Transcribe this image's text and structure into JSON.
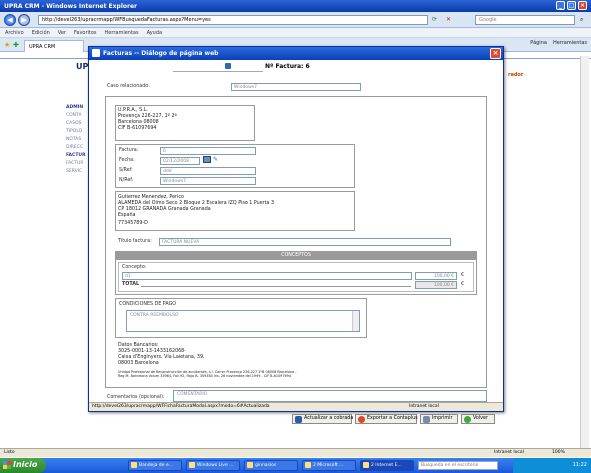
{
  "browser": {
    "title": "UPRA CRM - Windows Internet Explorer",
    "url": "http://devel263/upracrmapp/WFBusquedaFacturas.aspx?Menu=yes",
    "search_placeholder": "Google",
    "menu": [
      "Archivo",
      "Edición",
      "Ver",
      "Favoritos",
      "Herramientas",
      "Ayuda"
    ],
    "tab_label": "UPRA CRM",
    "tools": {
      "page": "Página",
      "tools": "Herramientas"
    },
    "status_text": "Listo",
    "zone": "Intranet local",
    "zoom": "100%"
  },
  "background_page": {
    "sidebar": [
      "ADMIN",
      "CONTA",
      "CASOS",
      "TIPOLO",
      "NOTAS",
      "DIRECC",
      "FACTUR",
      "FACTUR",
      "SERVIC"
    ],
    "brand_tail": "rador"
  },
  "dialog": {
    "title": "Facturas -- Diálogo de página web",
    "invoice_label": "Nº Factura: 6",
    "caso_label": "Caso relacionado:",
    "caso_value": "Windows7",
    "company": {
      "name": "U.P.R.A., S.L.",
      "address": "Provença 226-227, 1º 2ª",
      "city": "Barcelona 08008",
      "cif": "CIF B-61097694"
    },
    "fields": {
      "factura_label": "Factura:",
      "factura_value": "6",
      "fecha_label": "Fecha:",
      "fecha_value": "02/12/2008",
      "sref_label": "S/Ref:",
      "sref_value": "ddd",
      "nref_label": "N/Ref:",
      "nref_value": "Windows7"
    },
    "client": {
      "name": "Gutierrez Menendez, Perico",
      "address": "ALAMEDA del Olmo Seco 2 Bloque 2 Escalera IZQ Piso 1 Puerta 3",
      "city": "CP 18012 GRANADA Granada Granada",
      "country": "España",
      "nif": "77345789-D"
    },
    "titulo_label": "Título factura:",
    "titulo_value": "FACTURA NUEVA",
    "conceptos_header": "CONCEPTOS",
    "concepto_label": "Concepto:",
    "concepto_value": "d1",
    "concepto_amount": "100,00 €",
    "euro_symbol": "€",
    "total_label": "TOTAL",
    "total_amount": "100,00 €",
    "condiciones_label": "CONDICIONES DE PAGO",
    "condiciones_value": "CONTRA REEMBOLSO",
    "bank": {
      "title": "Datos Bancarios:",
      "account": "3025-0001-13-1433162068-",
      "bank_name": "Caixa d'Enginyers. Vía Laietana, 39.",
      "city": "08003 Barcelona"
    },
    "legal_line1": "Unidad Profesional de Reconstrucción de accidentes, s.l. Carrer Provença 226-227 1ºB 08008 Barcelona -",
    "legal_line2": "Reg M. Barcelona Volum 33964, Foli 92, Hoja B- 359384 Ins. 26 noviembre del 1999 - CIF B-61097694",
    "comentarios_label": "Comentarios (opcional):",
    "comentarios_placeholder": "COMENTARIO",
    "buttons": {
      "actualizar": "Actualizar a cobrada",
      "exportar": "Exportar a Contaplus",
      "imprimir": "Imprimir",
      "volver": "Volver"
    },
    "status_url": "http://devel263/upracrmapp/WFFichaFacturaModal.aspx?modo=6#Actualizada",
    "status_zone": "Intranet local"
  },
  "taskbar": {
    "start": "Inicio",
    "tasks": [
      "Bandeja de e...",
      "Windows Live ...",
      "ginnasios",
      "2 Microsoft ...",
      "2 Internet E..."
    ],
    "search_placeholder": "Busqueda en el escritorio",
    "clock": "11:22"
  }
}
